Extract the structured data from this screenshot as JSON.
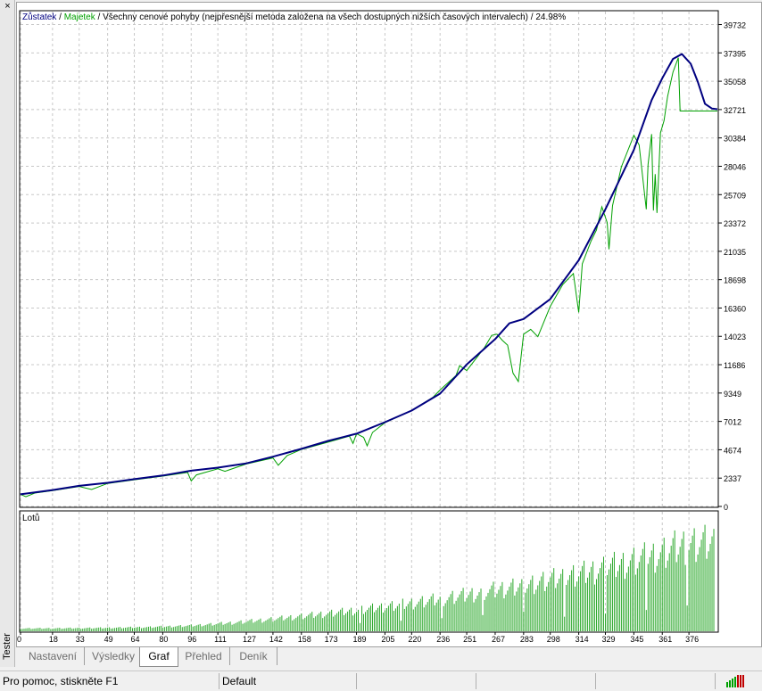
{
  "window": {
    "panel_label": "Tester",
    "close_glyph": "×"
  },
  "chart": {
    "legend": {
      "balance_label": "Zůstatek",
      "equity_label": "Majetek",
      "description": "Všechny cenové pohyby (nejpřesnější metoda založena na všech dostupných nižších časových intervalech)",
      "percent": "24.98%",
      "separator": " / "
    },
    "colors": {
      "balance": "#000080",
      "equity": "#00a000",
      "grid": "#c8c8c8",
      "lots": "#2ca82c"
    },
    "lots_label": "Lotů"
  },
  "chart_data": [
    {
      "type": "line",
      "title": "",
      "y_ticks": [
        0,
        2337,
        4674,
        7012,
        9349,
        11686,
        14023,
        16360,
        18698,
        21035,
        23372,
        25709,
        28046,
        30384,
        32721,
        35058,
        37395,
        39732
      ],
      "ylim": [
        0,
        40800
      ],
      "xlim": [
        0,
        392
      ],
      "x_ticks": [
        0,
        18,
        33,
        49,
        64,
        80,
        96,
        111,
        127,
        142,
        158,
        173,
        189,
        205,
        220,
        236,
        251,
        267,
        283,
        298,
        314,
        329,
        345,
        361,
        376
      ],
      "series": [
        {
          "name": "Zůstatek",
          "points": [
            [
              0,
              1000
            ],
            [
              18,
              1350
            ],
            [
              33,
              1700
            ],
            [
              49,
              1950
            ],
            [
              64,
              2250
            ],
            [
              80,
              2550
            ],
            [
              96,
              2950
            ],
            [
              111,
              3200
            ],
            [
              127,
              3550
            ],
            [
              142,
              4100
            ],
            [
              158,
              4750
            ],
            [
              173,
              5400
            ],
            [
              189,
              6000
            ],
            [
              205,
              6950
            ],
            [
              220,
              7900
            ],
            [
              236,
              9300
            ],
            [
              251,
              11700
            ],
            [
              267,
              13800
            ],
            [
              275,
              15100
            ],
            [
              283,
              15450
            ],
            [
              298,
              17100
            ],
            [
              314,
              20300
            ],
            [
              329,
              24500
            ],
            [
              345,
              29400
            ],
            [
              355,
              33500
            ],
            [
              361,
              35300
            ],
            [
              367,
              36900
            ],
            [
              372,
              37300
            ],
            [
              377,
              36500
            ],
            [
              381,
              35000
            ],
            [
              385,
              33200
            ],
            [
              389,
              32800
            ],
            [
              392,
              32750
            ]
          ]
        },
        {
          "name": "Majetek",
          "points": [
            [
              0,
              1000
            ],
            [
              3,
              800
            ],
            [
              8,
              1100
            ],
            [
              18,
              1300
            ],
            [
              33,
              1650
            ],
            [
              40,
              1400
            ],
            [
              49,
              1900
            ],
            [
              64,
              2200
            ],
            [
              80,
              2500
            ],
            [
              94,
              2800
            ],
            [
              96,
              2100
            ],
            [
              99,
              2600
            ],
            [
              111,
              3100
            ],
            [
              115,
              2900
            ],
            [
              127,
              3500
            ],
            [
              142,
              4000
            ],
            [
              145,
              3400
            ],
            [
              150,
              4200
            ],
            [
              158,
              4700
            ],
            [
              173,
              5300
            ],
            [
              185,
              5800
            ],
            [
              187,
              5200
            ],
            [
              189,
              6000
            ],
            [
              193,
              5700
            ],
            [
              195,
              5000
            ],
            [
              198,
              6100
            ],
            [
              205,
              6900
            ],
            [
              220,
              7900
            ],
            [
              232,
              9000
            ],
            [
              236,
              9600
            ],
            [
              245,
              10800
            ],
            [
              247,
              11600
            ],
            [
              251,
              11200
            ],
            [
              261,
              13100
            ],
            [
              265,
              14100
            ],
            [
              268,
              14200
            ],
            [
              271,
              13700
            ],
            [
              274,
              13300
            ],
            [
              277,
              11000
            ],
            [
              280,
              10300
            ],
            [
              283,
              14200
            ],
            [
              287,
              14600
            ],
            [
              291,
              14000
            ],
            [
              298,
              16500
            ],
            [
              305,
              18300
            ],
            [
              311,
              19200
            ],
            [
              314,
              16000
            ],
            [
              316,
              20000
            ],
            [
              321,
              21900
            ],
            [
              324,
              22800
            ],
            [
              327,
              24700
            ],
            [
              330,
              23400
            ],
            [
              331,
              21200
            ],
            [
              333,
              24800
            ],
            [
              338,
              28000
            ],
            [
              345,
              30600
            ],
            [
              348,
              29800
            ],
            [
              351,
              25800
            ],
            [
              352,
              24500
            ],
            [
              353,
              28200
            ],
            [
              355,
              30700
            ],
            [
              356,
              24400
            ],
            [
              357,
              27400
            ],
            [
              358,
              24200
            ],
            [
              360,
              30800
            ],
            [
              362,
              31800
            ],
            [
              364,
              33800
            ],
            [
              367,
              35800
            ],
            [
              370,
              37000
            ],
            [
              371,
              32600
            ],
            [
              392,
              32600
            ]
          ]
        }
      ]
    },
    {
      "type": "bar",
      "title": "",
      "bars": [
        [
          0,
          0.3
        ],
        [
          24,
          0.32
        ],
        [
          48,
          0.36
        ],
        [
          72,
          0.44
        ],
        [
          96,
          0.6
        ],
        [
          120,
          0.92
        ],
        [
          144,
          1.33
        ],
        [
          168,
          1.8
        ],
        [
          192,
          2.3
        ],
        [
          216,
          2.9
        ],
        [
          240,
          3.55
        ],
        [
          264,
          4.3
        ],
        [
          288,
          5.15
        ],
        [
          312,
          6.0
        ],
        [
          336,
          7.1
        ],
        [
          360,
          8.3
        ],
        [
          372,
          9.2
        ],
        [
          392,
          9.5
        ]
      ],
      "ylim": [
        0,
        10
      ]
    }
  ],
  "tabs": [
    {
      "label": "Nastavení"
    },
    {
      "label": "Výsledky"
    },
    {
      "label": "Graf"
    },
    {
      "label": "Přehled"
    },
    {
      "label": "Deník"
    }
  ],
  "statusbar": {
    "help_text": "Pro pomoc, stiskněte F1",
    "profile": "Default"
  }
}
